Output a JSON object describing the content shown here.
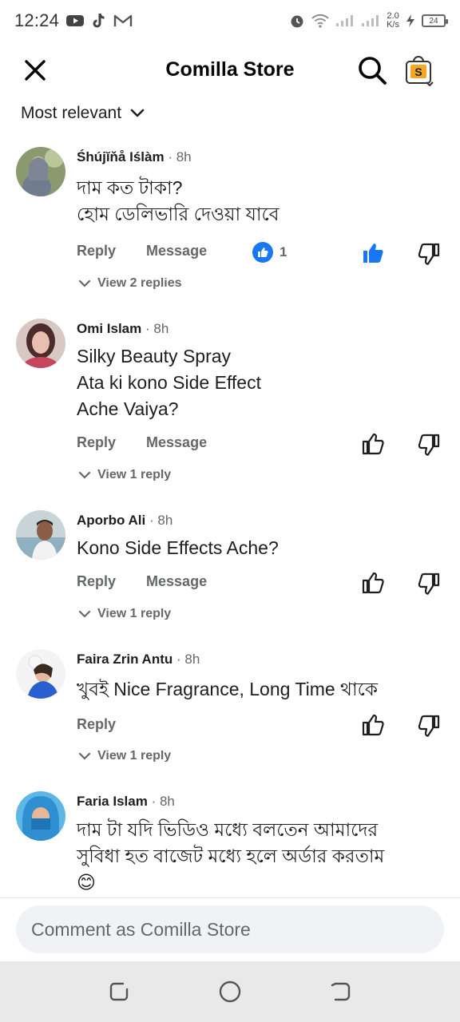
{
  "status_bar": {
    "time": "12:24",
    "net_speed_value": "2.0",
    "net_speed_unit": "K/s",
    "battery": "24"
  },
  "header": {
    "title": "Comilla Store"
  },
  "filter": {
    "label": "Most relevant"
  },
  "actions": {
    "reply": "Reply",
    "message": "Message"
  },
  "comments": [
    {
      "name": "Śhújĭňå Iślàm",
      "time": "· 8h",
      "text": "দাম কত টাকা?\nহোম ডেলিভারি দেওয়া যাবে",
      "reactions": "1",
      "liked": true,
      "replies": "View 2 replies"
    },
    {
      "name": "Omi Islam",
      "time": " · 8h",
      "text": "Silky Beauty  Spray\nAta ki kono Side Effect\nAche Vaiya?",
      "replies": "View 1 reply"
    },
    {
      "name": "Aporbo Ali",
      "time": "· 8h",
      "text": "Kono Side Effects Ache?",
      "replies": "View 1 reply"
    },
    {
      "name": "Faira Zrin Antu",
      "time": "· 8h",
      "text": "খুবই Nice Fragrance, Long Time থাকে",
      "replies": "View 1 reply"
    },
    {
      "name": "Faria Islam",
      "time": " · 8h",
      "text": "দাম টা যদি ভিডিও মধ্যে বলতেন আমাদের\nসুবিধা হত বাজেট মধ্যে হলে অর্ডার করতাম\n😊"
    }
  ],
  "composer": {
    "placeholder": "Comment as Comilla Store"
  },
  "colors": {
    "accent": "#1877f2",
    "secondary_text": "#65676b"
  }
}
